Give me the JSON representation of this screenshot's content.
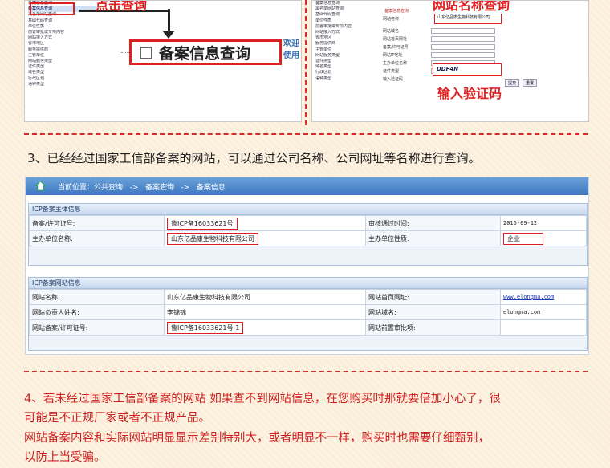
{
  "top_left": {
    "callout": "点击查询",
    "tree_items": [
      "备案信息查询",
      "备案信息查询",
      "黑名单网站查询",
      "基础代码查询",
      "单位性质",
      "前置审批或专项内容",
      "网站接入方式",
      "省市地区",
      "服务提供商",
      "主管单位",
      "网站服务类型",
      "证件类型",
      "域名类型",
      "行政区划",
      "语种类型"
    ],
    "button_label": "备案信息查询",
    "welcome": "欢迎使用"
  },
  "top_right": {
    "callout": "网站名称查询",
    "company_value": "山东亿品康生物科技有限公司",
    "hint": "备案信息查询",
    "captcha_value": "DDF4N",
    "captcha_label": "输入验证码",
    "form_labels": [
      "网站名称",
      "网站域名",
      "网站首页网址",
      "备案/许可证号",
      "网站IP地址",
      "主办单位名称",
      "证件类型",
      "输入验证码"
    ],
    "buttons": [
      "提交",
      "重置"
    ]
  },
  "section3": {
    "text": "3、已经经过国家工信部备案的网站，可以通过公司名称、公司网址等名称进行查询。",
    "breadcrumb": "当前位置：公共查询   ->   备案查询   ->   备案信息",
    "icp_head": "ICP备案主体信息",
    "icp_rows": [
      [
        "备案/许可证号:",
        "鲁ICP备16033621号",
        "审核通过时间:",
        "2016-09-12"
      ],
      [
        "主办单位名称:",
        "山东亿品康生物科技有限公司",
        "主办单位性质:",
        "企业"
      ]
    ],
    "site_head": "ICP备案网站信息",
    "site_rows": [
      [
        "网站名称:",
        "山东亿品康生物科技有限公司",
        "网站首页网址:",
        "www.elongma.com"
      ],
      [
        "网站负责人姓名:",
        "李锦锦",
        "网站域名:",
        "elongma.com"
      ],
      [
        "网站备案/许可证号:",
        "鲁ICP备16033621号-1",
        "网站前置审批项:",
        ""
      ]
    ]
  },
  "section4": {
    "line1": "4、若未经过国家工信部备案的网站 如果查不到网站信息，在您购买时那就要倍加小心了，很",
    "line2": "可能是不正规厂家或者不正规产品。",
    "line3": "   网站备案内容和实际网站明显显示差别特别大，或者明显不一样，购买时也需要仔细甄别，",
    "line4": "以防上当受骗。"
  },
  "colors": {
    "accent_red": "#e02020",
    "header_blue": "#3e78c0",
    "background": "#fbefdc"
  }
}
